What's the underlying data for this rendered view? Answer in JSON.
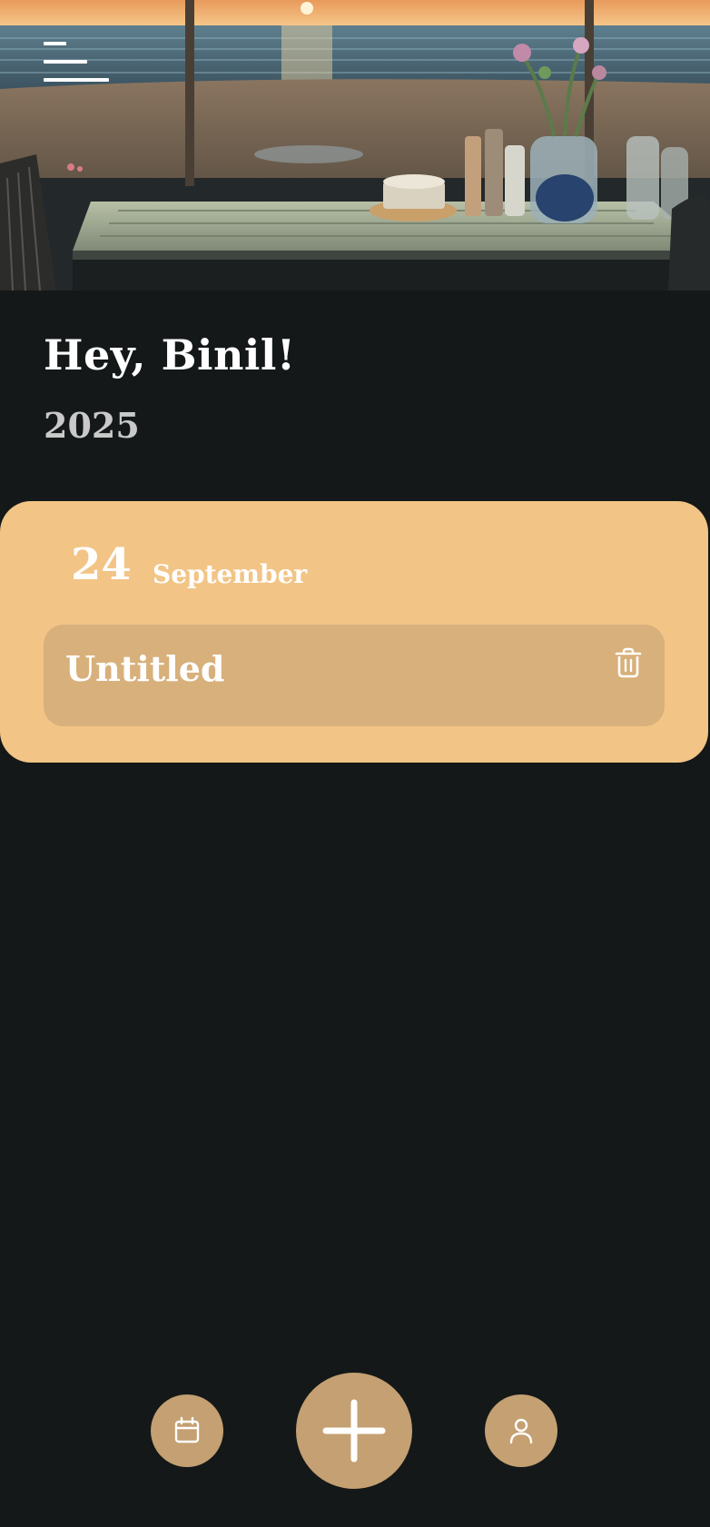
{
  "header": {
    "background_image": "sunset-beach-cafe-window-scene",
    "menu_icon": "hamburger-menu-icon"
  },
  "greeting": {
    "text": "Hey, Binil!",
    "year": "2025"
  },
  "day_group": {
    "day": "24",
    "month": "September",
    "entries": [
      {
        "title": "Untitled",
        "action_icon": "trash-icon"
      }
    ]
  },
  "bottom_nav": {
    "left_icon": "calendar-icon",
    "center_icon": "plus-icon",
    "right_icon": "user-icon"
  },
  "colors": {
    "background": "#141818",
    "card": "#f2c486",
    "entry": "#d8b07b",
    "nav_button": "#c4a072",
    "text": "#ffffff",
    "muted_text": "#c9c9c9"
  }
}
